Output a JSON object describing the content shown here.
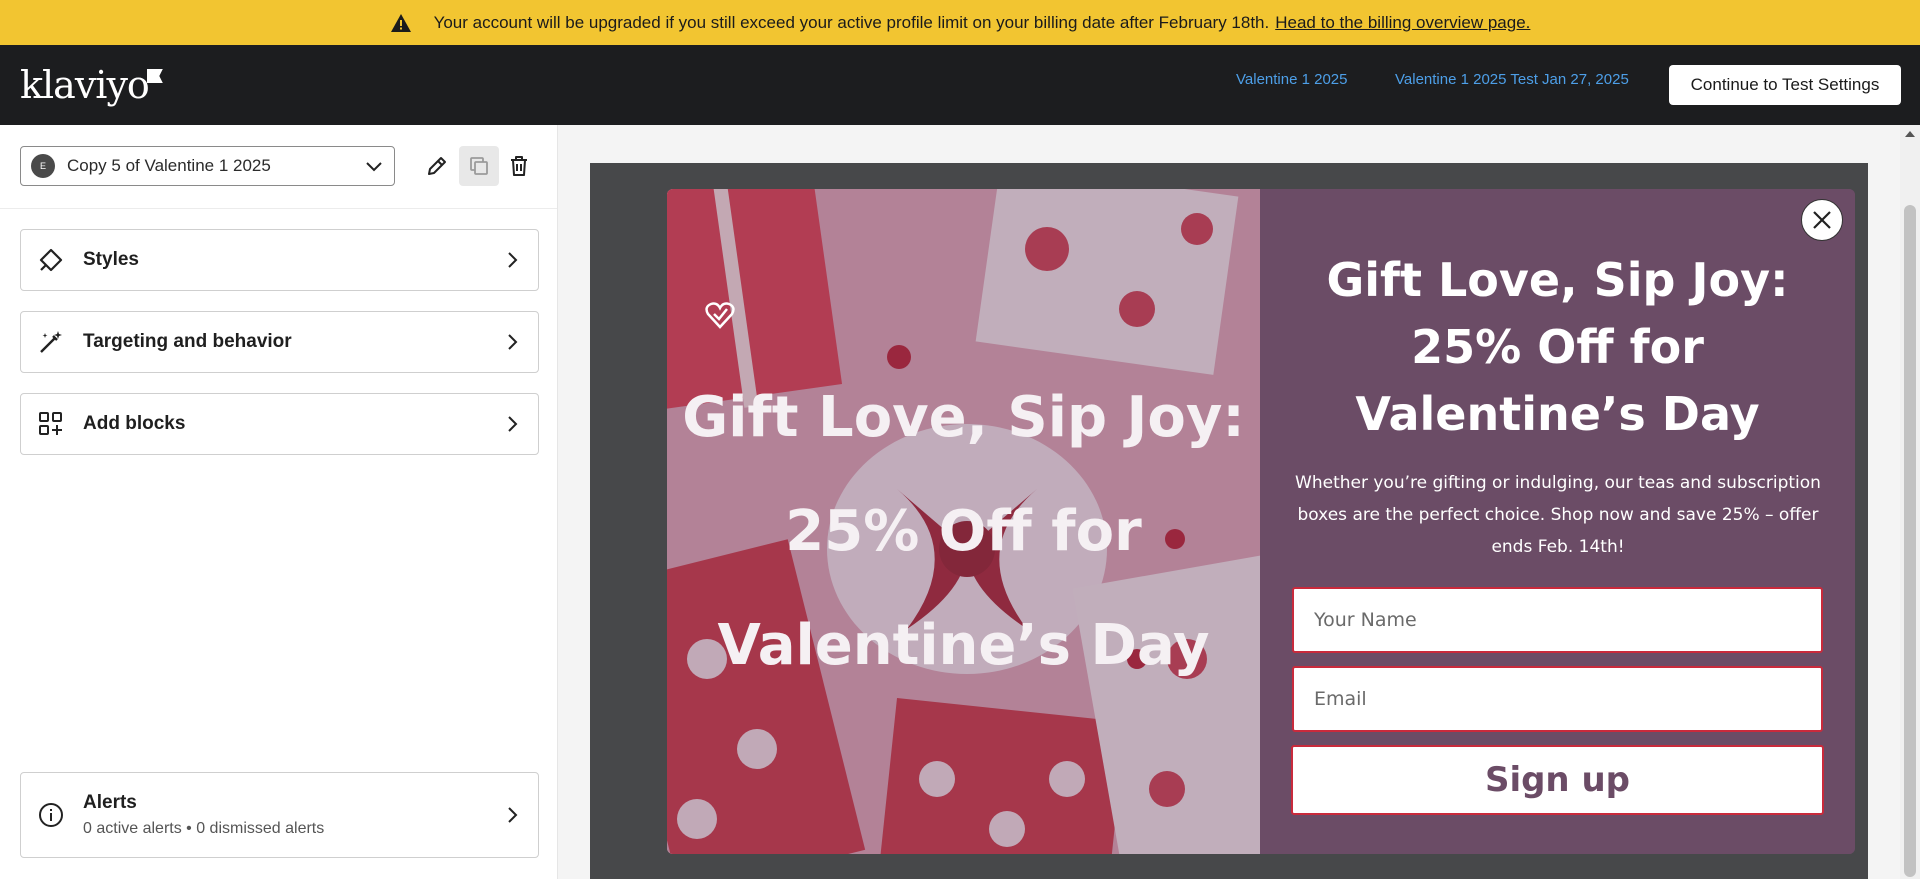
{
  "banner": {
    "icon": "warning-icon",
    "message": "Your account will be upgraded if you still exceed your active profile limit on your billing date after February 18th.",
    "link": "Head to the billing overview page."
  },
  "nav": {
    "logo": "klaviyo",
    "links": [
      "Valentine 1 2025",
      "Valentine 1 2025 Test Jan 27, 2025"
    ],
    "continue_label": "Continue to Test Settings"
  },
  "sidebar": {
    "form_badge": "E",
    "form_name": "Copy 5 of Valentine 1 2025",
    "panels": {
      "styles": "Styles",
      "targeting": "Targeting and behavior",
      "blocks": "Add blocks"
    },
    "alerts": {
      "title": "Alerts",
      "summary": "0 active alerts • 0 dismissed alerts"
    }
  },
  "popup": {
    "image_headline_lines": [
      "Gift Love, Sip Joy:",
      "25% Off for",
      "Valentine’s Day"
    ],
    "headline_lines": [
      "Gift Love, Sip Joy:",
      "25% Off for",
      "Valentine’s Day"
    ],
    "body": "Whether you’re gifting or indulging, our teas and subscription boxes are the perfect choice. Shop now and save 25% – offer ends Feb. 14th!",
    "name_placeholder": "Your Name",
    "email_placeholder": "Email",
    "submit_label": "Sign up",
    "colors": {
      "background": "#6b4c66",
      "accent": "#c92a3c",
      "banner": "#f2c531",
      "link": "#4d9fe8"
    }
  }
}
